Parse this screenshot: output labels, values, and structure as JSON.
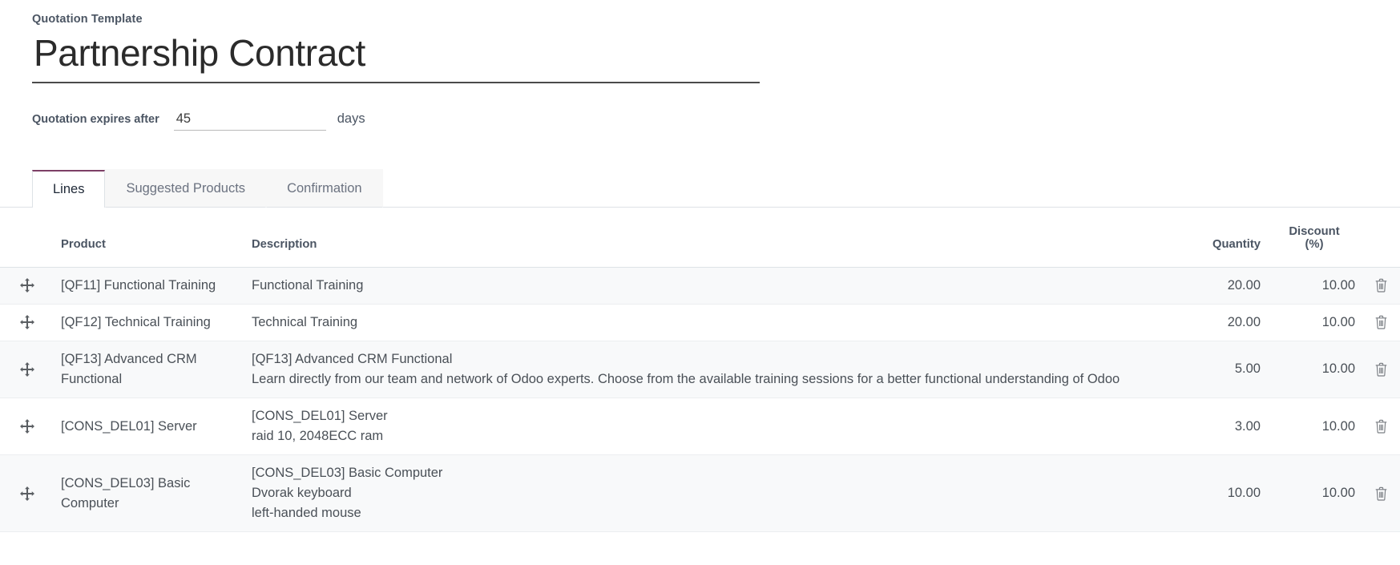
{
  "form": {
    "section_label": "Quotation Template",
    "title": "Partnership Contract",
    "expiry_label": "Quotation expires after",
    "expiry_value": "45",
    "expiry_placeholder": "",
    "expiry_unit": "days"
  },
  "tabs": [
    {
      "label": "Lines",
      "active": true
    },
    {
      "label": "Suggested Products",
      "active": false
    },
    {
      "label": "Confirmation",
      "active": false
    }
  ],
  "table": {
    "headers": {
      "handle": "",
      "product": "Product",
      "description": "Description",
      "quantity": "Quantity",
      "discount": "Discount\n(%)",
      "discount_line1": "Discount",
      "discount_line2": "(%)",
      "trash": ""
    },
    "rows": [
      {
        "product": "[QF11] Functional Training",
        "description": "Functional Training",
        "quantity": "20.00",
        "discount": "10.00"
      },
      {
        "product": "[QF12] Technical Training",
        "description": "Technical Training",
        "quantity": "20.00",
        "discount": "10.00"
      },
      {
        "product": "[QF13] Advanced CRM Functional",
        "description": "[QF13] Advanced CRM Functional\nLearn directly from our team and network of Odoo experts. Choose from the available training sessions for a better functional understanding of Odoo",
        "quantity": "5.00",
        "discount": "10.00"
      },
      {
        "product": "[CONS_DEL01] Server",
        "description": "[CONS_DEL01] Server\nraid 10, 2048ECC ram",
        "quantity": "3.00",
        "discount": "10.00"
      },
      {
        "product": "[CONS_DEL03] Basic Computer",
        "description": "[CONS_DEL03] Basic Computer\nDvorak keyboard\nleft-handed mouse",
        "quantity": "10.00",
        "discount": "10.00"
      }
    ]
  },
  "colors": {
    "active_tab_accent": "#7d3f66",
    "title_underline": "#4b4b4b",
    "row_stripe": "#f8f9fa",
    "text": "#4a5057",
    "label": "#4b5563"
  },
  "icons": {
    "row_handle": "move-icon",
    "row_delete": "trash-icon"
  }
}
